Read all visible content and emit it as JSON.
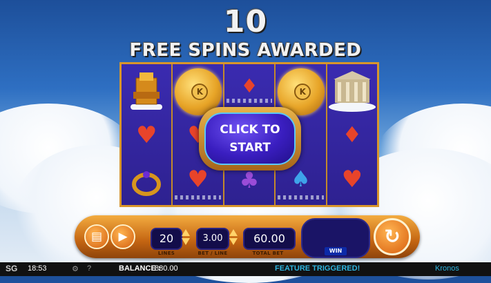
{
  "banner": {
    "count": "10",
    "message": "FREE SPINS AWARDED"
  },
  "reels": {
    "symbols": [
      [
        "throne",
        "heart",
        "bracelet"
      ],
      [
        "k-coin",
        "heart",
        "heart"
      ],
      [
        "diamond",
        "",
        "club"
      ],
      [
        "k-coin",
        "",
        "spade"
      ],
      [
        "temple",
        "diamond",
        "heart"
      ]
    ],
    "coin_letter": "K"
  },
  "start_button": {
    "line1": "CLICK TO",
    "line2": "START"
  },
  "console": {
    "lines_value": "20",
    "lines_label": "LINES",
    "bet_value": "3.00",
    "bet_label": "BET / LINE",
    "total_value": "60.00",
    "total_label": "TOTAL BET",
    "win_label": "WIN",
    "paytable_icon": "info-icon",
    "autoplay_icon": "autoplay-icon",
    "spin_icon": "spin-icon"
  },
  "statusbar": {
    "logo": "SG",
    "time": "18:53",
    "balance_label": "BALANCE :",
    "balance_value": "880.00",
    "message": "FEATURE TRIGGERED!",
    "game_name": "Kronos"
  },
  "colors": {
    "reel_bg": "#3a2bb0",
    "frame_gold": "#d9962a",
    "console_orange": "#e08420",
    "status_text": "#2fb6e0"
  }
}
